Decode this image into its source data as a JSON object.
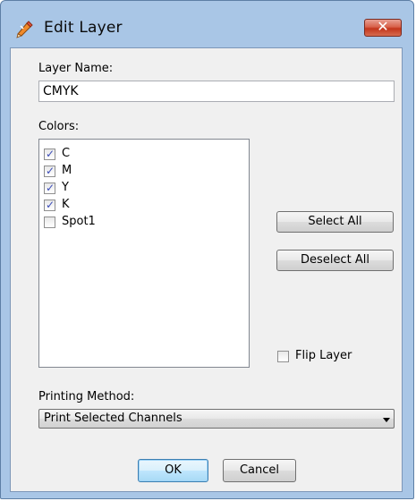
{
  "window": {
    "title": "Edit Layer",
    "close_label": "✕",
    "app_icon": "pencil-icon"
  },
  "layer_name": {
    "label": "Layer Name:",
    "value": "CMYK"
  },
  "colors": {
    "label": "Colors:",
    "items": [
      {
        "label": "C",
        "checked": true
      },
      {
        "label": "M",
        "checked": true
      },
      {
        "label": "Y",
        "checked": true
      },
      {
        "label": "K",
        "checked": true
      },
      {
        "label": "Spot1",
        "checked": false
      }
    ]
  },
  "buttons": {
    "select_all": "Select All",
    "deselect_all": "Deselect All",
    "ok": "OK",
    "cancel": "Cancel"
  },
  "flip_layer": {
    "label": "Flip Layer",
    "checked": false
  },
  "printing_method": {
    "label": "Printing Method:",
    "selected": "Print Selected Channels"
  },
  "colors_theme": {
    "frame": "#a9c6e6",
    "close_button": "#c3351c",
    "checkmark": "#3b4cb8"
  }
}
